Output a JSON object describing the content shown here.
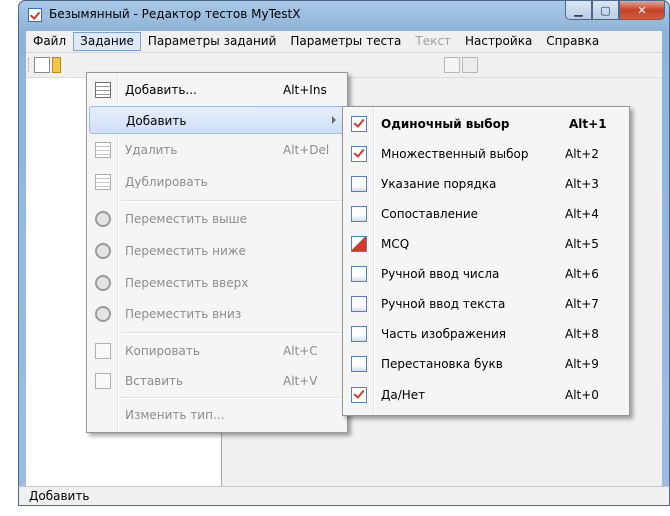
{
  "window": {
    "title": "Безымянный - Редактор тестов MyTestX"
  },
  "menubar": {
    "items": [
      {
        "label": "Файл",
        "state": "normal"
      },
      {
        "label": "Задание",
        "state": "active"
      },
      {
        "label": "Параметры заданий",
        "state": "normal"
      },
      {
        "label": "Параметры теста",
        "state": "normal"
      },
      {
        "label": "Текст",
        "state": "disabled"
      },
      {
        "label": "Настройка",
        "state": "normal"
      },
      {
        "label": "Справка",
        "state": "normal"
      }
    ]
  },
  "task_menu": {
    "items": [
      {
        "label": "Добавить...",
        "shortcut": "Alt+Ins",
        "enabled": true,
        "icon": "add-task-icon"
      },
      {
        "label": "Добавить",
        "shortcut": "",
        "enabled": true,
        "highlighted": true,
        "submenu": true
      },
      {
        "label": "Удалить",
        "shortcut": "Alt+Del",
        "enabled": false,
        "icon": "delete-task-icon"
      },
      {
        "label": "Дублировать",
        "shortcut": "",
        "enabled": false,
        "icon": "duplicate-task-icon"
      },
      {
        "label": "Переместить выше",
        "shortcut": "",
        "enabled": false,
        "icon": "move-up-icon"
      },
      {
        "label": "Переместить ниже",
        "shortcut": "",
        "enabled": false,
        "icon": "move-down-icon"
      },
      {
        "label": "Переместить вверх",
        "shortcut": "",
        "enabled": false,
        "icon": "move-top-icon"
      },
      {
        "label": "Переместить вниз",
        "shortcut": "",
        "enabled": false,
        "icon": "move-bottom-icon"
      },
      {
        "label": "Копировать",
        "shortcut": "Alt+C",
        "enabled": false,
        "icon": "copy-icon"
      },
      {
        "label": "Вставить",
        "shortcut": "Alt+V",
        "enabled": false,
        "icon": "paste-icon"
      },
      {
        "label": "Изменить тип...",
        "shortcut": "",
        "enabled": false
      }
    ]
  },
  "add_submenu": {
    "items": [
      {
        "label": "Одиночный выбор",
        "shortcut": "Alt+1",
        "bold": true,
        "icon": "single-choice-icon"
      },
      {
        "label": "Множественный выбор",
        "shortcut": "Alt+2",
        "icon": "multiple-choice-icon"
      },
      {
        "label": "Указание порядка",
        "shortcut": "Alt+3",
        "icon": "ordering-icon"
      },
      {
        "label": "Сопоставление",
        "shortcut": "Alt+4",
        "icon": "matching-icon"
      },
      {
        "label": "MCQ",
        "shortcut": "Alt+5",
        "icon": "mcq-icon"
      },
      {
        "label": "Ручной ввод числа",
        "shortcut": "Alt+6",
        "icon": "number-input-icon"
      },
      {
        "label": "Ручной ввод текста",
        "shortcut": "Alt+7",
        "icon": "text-input-icon"
      },
      {
        "label": "Часть изображения",
        "shortcut": "Alt+8",
        "icon": "image-part-icon"
      },
      {
        "label": "Перестановка букв",
        "shortcut": "Alt+9",
        "icon": "letter-permutation-icon"
      },
      {
        "label": "Да/Нет",
        "shortcut": "Alt+0",
        "icon": "yes-no-icon"
      }
    ]
  },
  "status": {
    "text": "Добавить"
  }
}
